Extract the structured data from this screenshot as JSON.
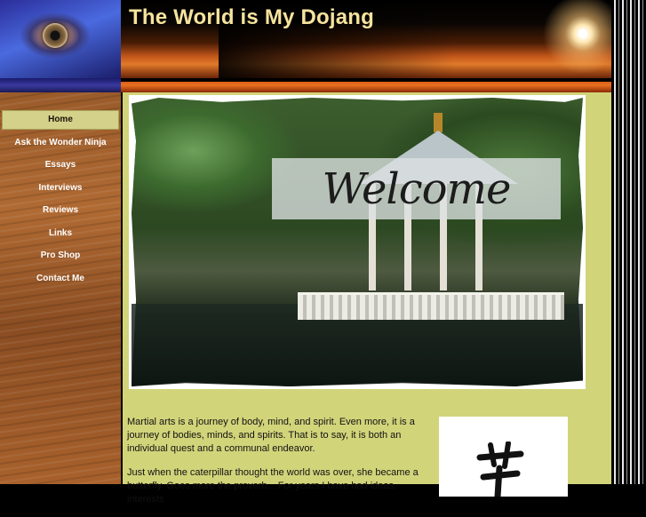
{
  "header": {
    "site_title": "The World is My Dojang"
  },
  "nav": {
    "items": [
      {
        "label": "Home",
        "active": true
      },
      {
        "label": "Ask the Wonder Ninja",
        "active": false
      },
      {
        "label": "Essays",
        "active": false
      },
      {
        "label": "Interviews",
        "active": false
      },
      {
        "label": "Reviews",
        "active": false
      },
      {
        "label": "Links",
        "active": false
      },
      {
        "label": "Pro Shop",
        "active": false
      },
      {
        "label": "Contact Me",
        "active": false
      }
    ]
  },
  "main": {
    "welcome_sign_text": "Welcome",
    "intro_paragraphs": [
      "Martial arts is a journey of body, mind, and spirit.  Even more, it is a journey of bodies, minds, and spirits.  That is to say, it is both an individual quest and a communal endeavor.",
      "Just when the caterpillar thought the world was over, she became a butterfly. Goes more the proverb... For years I have had ideas, interests"
    ]
  },
  "colors": {
    "content_bg": "#d2d47a",
    "nav_active_bg": "#d4d18a",
    "title_color": "#f6e39c"
  },
  "icons": {
    "logo": "eye-logo",
    "calligraphy": "calligraphy-character"
  }
}
